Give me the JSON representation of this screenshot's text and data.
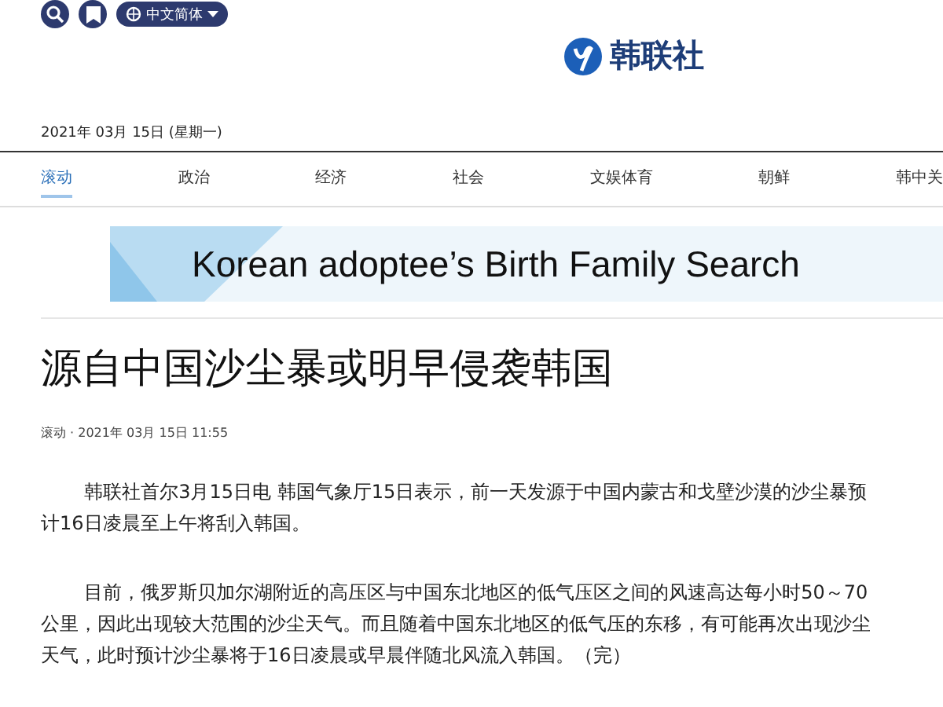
{
  "header": {
    "language": "中文简体",
    "logo": "韩联社",
    "date": "2021年 03月 15日 (星期一)"
  },
  "nav": [
    {
      "label": "滚动",
      "selected": true
    },
    {
      "label": "政治",
      "selected": false
    },
    {
      "label": "经济",
      "selected": false
    },
    {
      "label": "社会",
      "selected": false
    },
    {
      "label": "文娱体育",
      "selected": false
    },
    {
      "label": "朝鲜",
      "selected": false
    },
    {
      "label": "韩中关",
      "selected": false
    }
  ],
  "banner": {
    "text": "Korean adoptee’s Birth Family Search"
  },
  "article": {
    "title": "源自中国沙尘暴或明早侵袭韩国",
    "meta": "滚动 · 2021年 03月 15日 11:55",
    "paragraphs": [
      "韩联社首尔3月15日电 韩国气象厅15日表示，前一天发源于中国内蒙古和戈壁沙漠的沙尘暴预计16日凌晨至上午将刮入韩国。",
      "目前，俄罗斯贝加尔湖附近的高压区与中国东北地区的低气压区之间的风速高达每小时50～70公里，因此出现较大范围的沙尘天气。而且随着中国东北地区的低气压的东移，有可能再次出现沙尘天气，此时预计沙尘暴将于16日凌晨或早晨伴随北风流入韩国。（完）"
    ]
  }
}
